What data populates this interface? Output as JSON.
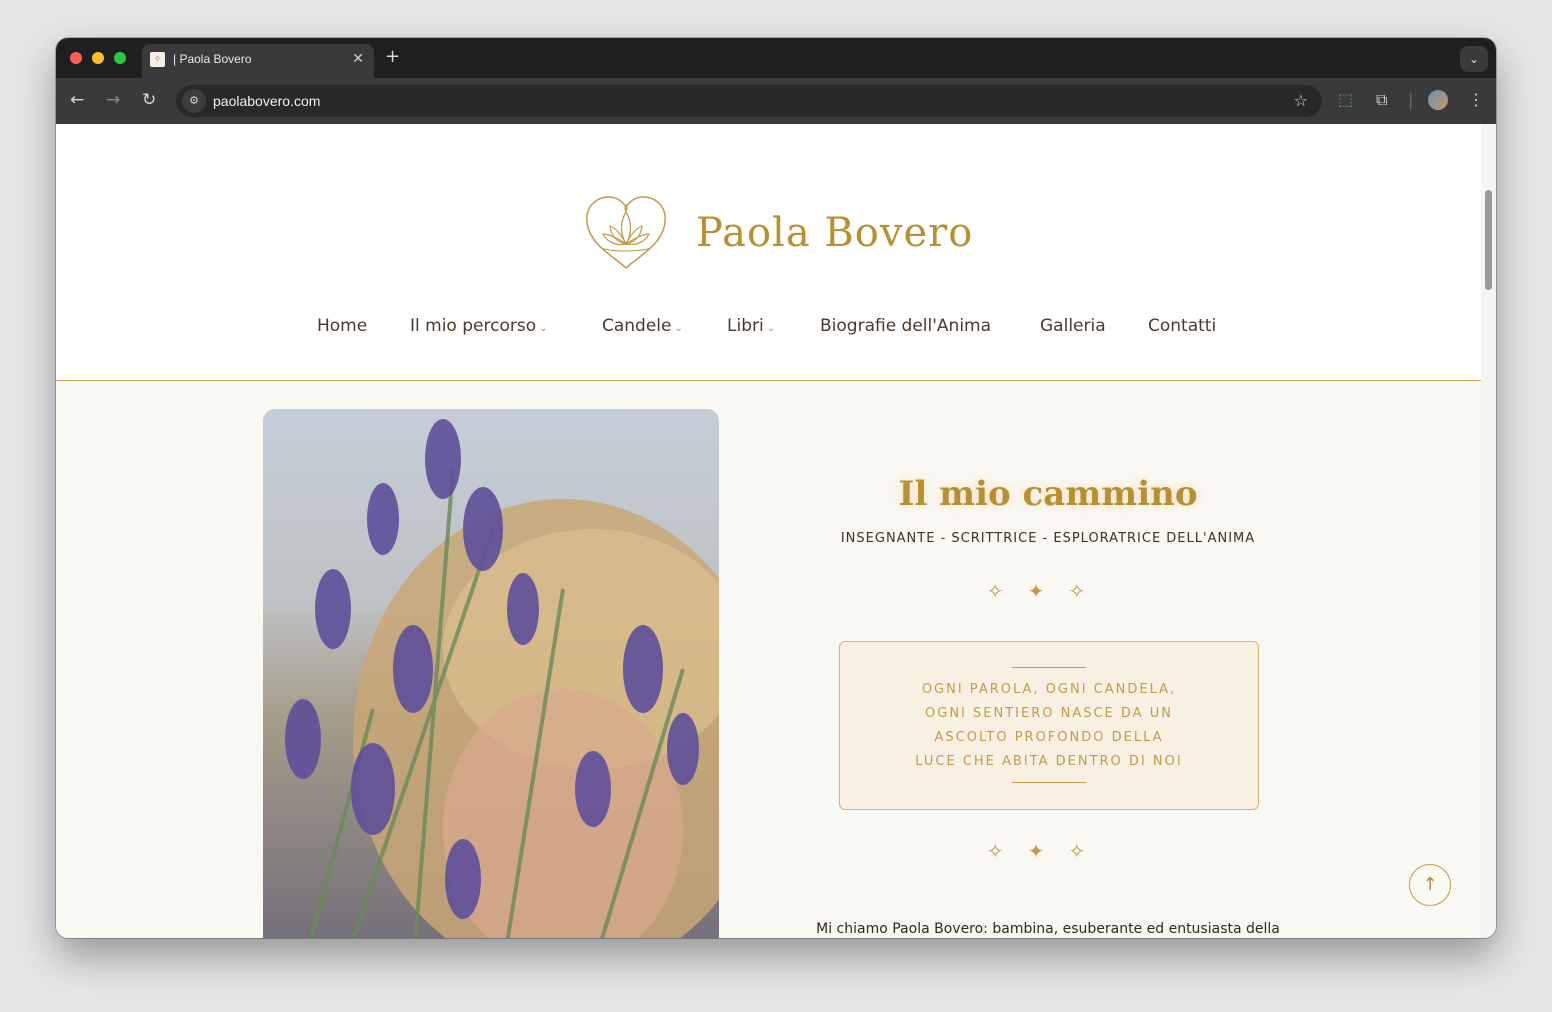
{
  "browser": {
    "tab_title": "| Paola Bovero",
    "url": "paolabovero.com"
  },
  "site": {
    "brand": "Paola Bovero",
    "nav": [
      {
        "label": "Home",
        "has_dropdown": false
      },
      {
        "label": "Il mio percorso",
        "has_dropdown": true
      },
      {
        "label": "Candele",
        "has_dropdown": true
      },
      {
        "label": "Libri",
        "has_dropdown": true
      },
      {
        "label": "Biografie dell'Anima",
        "has_dropdown": false
      },
      {
        "label": "Galleria",
        "has_dropdown": false
      },
      {
        "label": "Contatti",
        "has_dropdown": false
      }
    ]
  },
  "hero": {
    "title": "Il mio cammino",
    "subtitle": "INSEGNANTE - SCRITTRICE - ESPLORATRICE DELL'ANIMA",
    "quote_lines": [
      "OGNI PAROLA, OGNI CANDELA,",
      "OGNI SENTIERO NASCE DA UN",
      "ASCOLTO PROFONDO DELLA",
      "LUCE CHE ABITA DENTRO DI NOI"
    ],
    "intro": "Mi chiamo Paola Bovero: bambina, esuberante ed entusiasta della"
  },
  "colors": {
    "accent": "#b98f34",
    "page_background": "#faf8f2",
    "browser_chrome": "#3a3a3c"
  }
}
